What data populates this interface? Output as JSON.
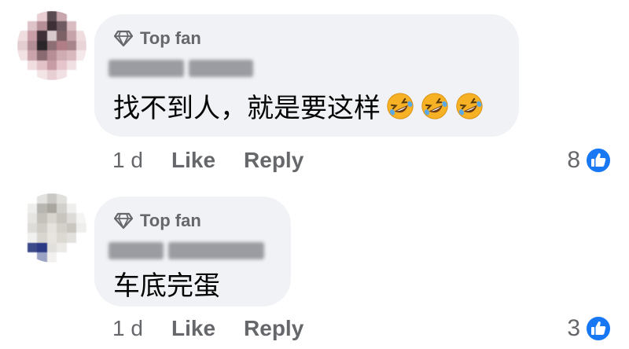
{
  "comments": [
    {
      "badge": "Top fan",
      "text": "找不到人，就是要这样",
      "emoji_count": 3,
      "time": "1 d",
      "like_label": "Like",
      "reply_label": "Reply",
      "reaction_count": "8"
    },
    {
      "badge": "Top fan",
      "text": "车底完蛋",
      "emoji_count": 0,
      "time": "1 d",
      "like_label": "Like",
      "reply_label": "Reply",
      "reaction_count": "3"
    }
  ],
  "colors": {
    "bubble": "#f0f2f5",
    "secondary_text": "#65676b",
    "like_blue": "#1877f2",
    "emoji_yellow": "#f7b125"
  },
  "icons": {
    "badge": "diamond-icon",
    "emoji": "rolling-on-floor-laughing-emoji",
    "reaction": "like-thumbs-up-icon"
  }
}
